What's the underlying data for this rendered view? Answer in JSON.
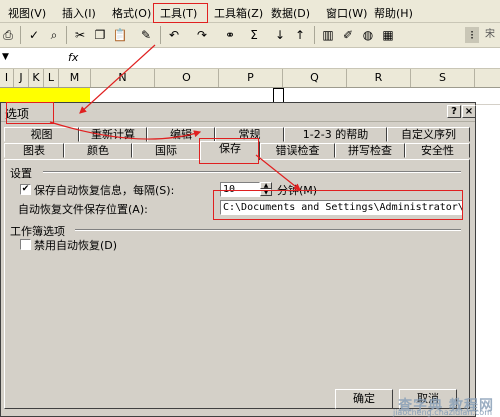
{
  "menubar": {
    "items": [
      "视图(V)",
      "插入(I)",
      "格式(O)",
      "工具(T)",
      "工具箱(Z)",
      "数据(D)",
      "窗口(W)",
      "帮助(H)"
    ]
  },
  "formulabar": {
    "fx": "fx"
  },
  "sheet": {
    "columns": [
      "I",
      "J",
      "K",
      "L",
      "M",
      "N",
      "O",
      "P",
      "Q",
      "R",
      "S"
    ]
  },
  "dialog": {
    "title": "选项",
    "help_button": "?",
    "close_button": "×",
    "tabs_row1": [
      "视图",
      "重新计算",
      "编辑",
      "常规",
      "1-2-3 的帮助",
      "自定义序列"
    ],
    "tabs_row2": [
      "图表",
      "颜色",
      "国际",
      "保存",
      "错误检查",
      "拼写检查",
      "安全性"
    ],
    "active_tab": "保存",
    "settings_group": "设置",
    "autorecover_label": "保存自动恢复信息，每隔(S):",
    "autorecover_checked": true,
    "minutes_value": "10",
    "minutes_unit": "分钟(M)",
    "location_label": "自动恢复文件保存位置(A):",
    "location_value": "C:\\Documents and Settings\\Administrator\\Applic",
    "workbook_group": "工作簿选项",
    "disable_label": "禁用自动恢复(D)",
    "disable_checked": false,
    "ok_button": "确定",
    "cancel_button": "取消"
  },
  "watermark": {
    "main": "查字典 教程网",
    "sub": "jiaocheng.chazidian.com"
  },
  "colors": {
    "annotation": "#e02020",
    "highlight_cell": "#ffff00",
    "chrome": "#ece9d8",
    "dialog": "#d4d0c8"
  }
}
